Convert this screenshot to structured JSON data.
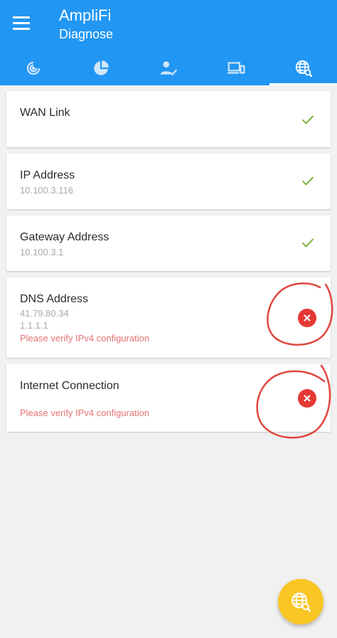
{
  "app": {
    "title": "AmpliFi",
    "subtitle": "Diagnose"
  },
  "tabs": [
    {
      "icon": "radar-icon",
      "active": false
    },
    {
      "icon": "pie-chart-icon",
      "active": false
    },
    {
      "icon": "user-check-icon",
      "active": false
    },
    {
      "icon": "devices-icon",
      "active": false
    },
    {
      "icon": "globe-search-icon",
      "active": true
    }
  ],
  "checks": {
    "wan": {
      "title": "WAN Link",
      "status": "ok"
    },
    "ip": {
      "title": "IP Address",
      "value": "10.100.3.116",
      "status": "ok"
    },
    "gateway": {
      "title": "Gateway Address",
      "value": "10.100.3.1",
      "status": "ok"
    },
    "dns": {
      "title": "DNS Address",
      "value1": "41.79.80.34",
      "value2": "1.1.1.1",
      "warning": "Please verify IPv4 configuration",
      "status": "error"
    },
    "internet": {
      "title": "Internet Connection",
      "warning": "Please verify IPv4 configuration",
      "status": "error"
    }
  },
  "colors": {
    "primary": "#2196f3",
    "ok": "#7cb342",
    "error": "#e53935",
    "warning_text": "#e57373",
    "fab": "#f9c623",
    "annotation": "#e0463f"
  },
  "fab": {
    "icon": "globe-search-icon"
  }
}
